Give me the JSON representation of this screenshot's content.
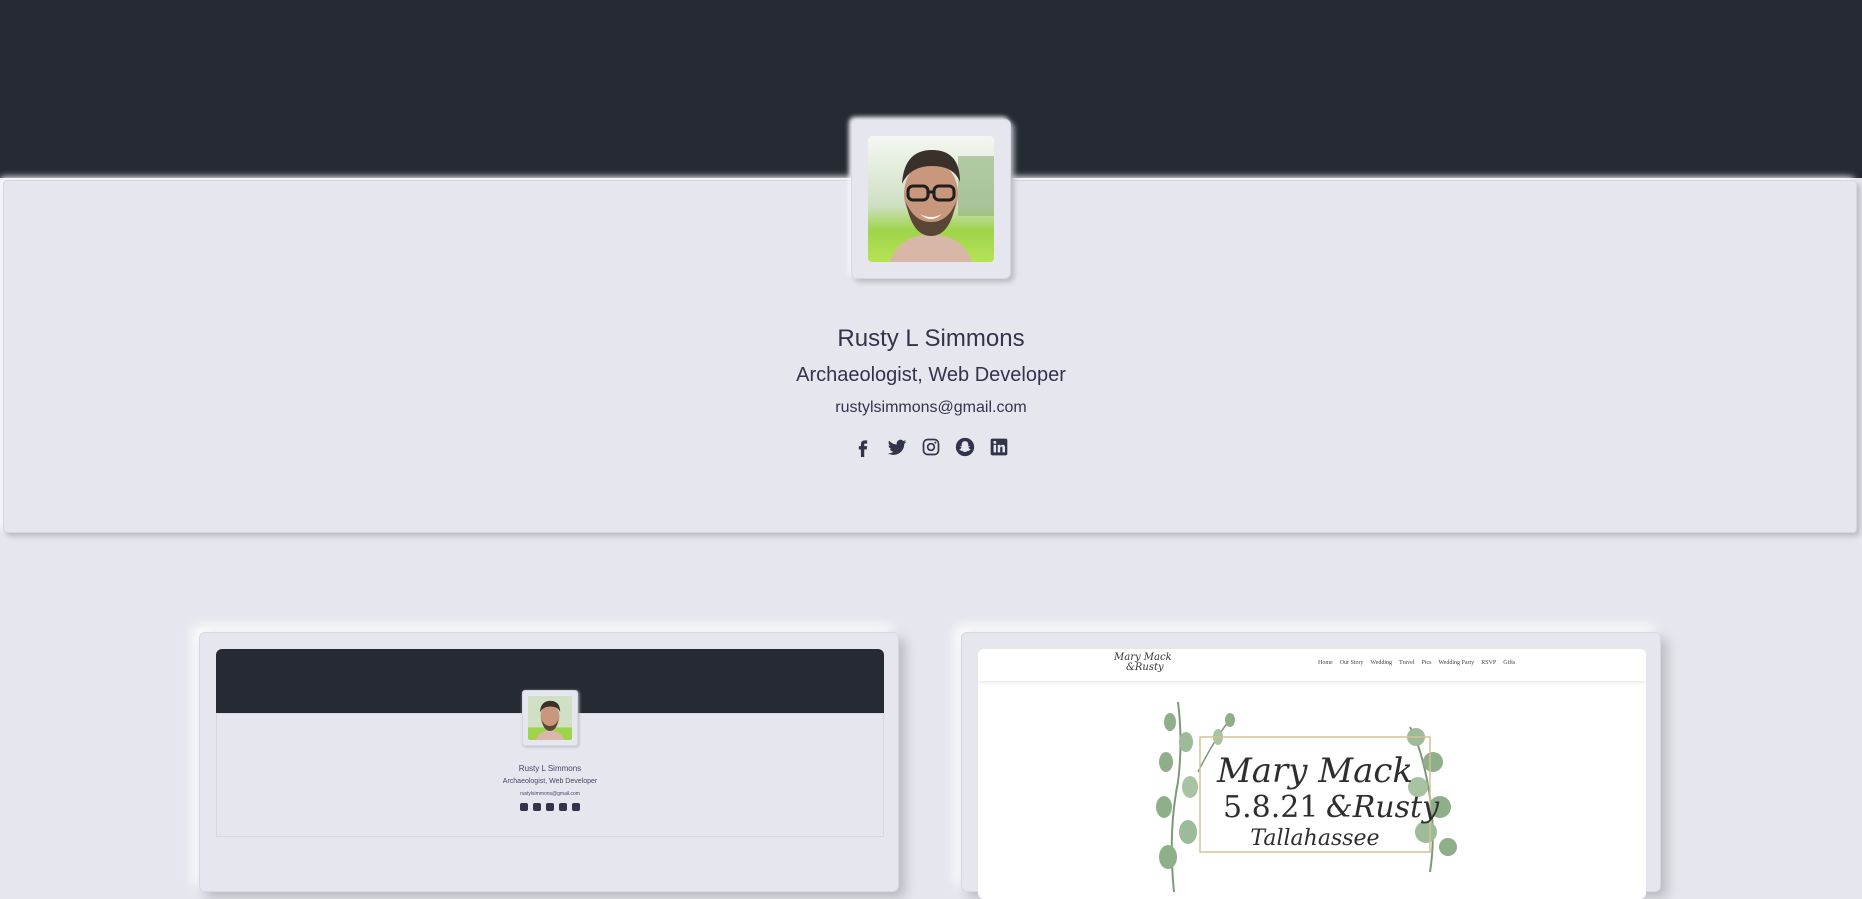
{
  "profile": {
    "name": "Rusty L Simmons",
    "title": "Archaeologist, Web Developer",
    "email": "rustylsimmons@gmail.com",
    "avatar_alt": "profile-photo",
    "socials": [
      {
        "icon": "facebook-icon"
      },
      {
        "icon": "twitter-icon"
      },
      {
        "icon": "instagram-icon"
      },
      {
        "icon": "snapchat-icon"
      },
      {
        "icon": "linkedin-icon"
      }
    ]
  },
  "projects": [
    {
      "id": "portfolio",
      "preview": {
        "name": "Rusty L Simmons",
        "title": "Archaeologist, Web Developer",
        "email": "rustylsimmons@gmail.com"
      }
    },
    {
      "id": "wedding",
      "preview": {
        "logo_line1": "Mary Mack",
        "logo_line2": "&Rusty",
        "nav": [
          "Home",
          "Our Story",
          "Wedding",
          "Travel",
          "Pics",
          "Wedding Party",
          "RSVP",
          "Gifts"
        ],
        "hero_names_1": "Mary Mack",
        "hero_date": "5.8.21",
        "hero_names_2": "&Rusty",
        "hero_place": "Tallahassee"
      }
    }
  ],
  "colors": {
    "banner": "#262a33",
    "background": "#e6e7ee",
    "text": "#31344b"
  }
}
